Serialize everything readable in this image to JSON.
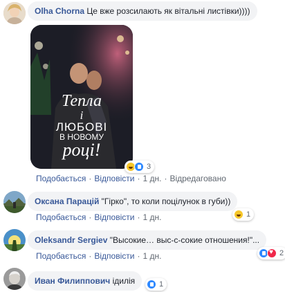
{
  "comments": [
    {
      "author": "Olha Chorna",
      "text": "Це вже розсилають як вітальні листівки))))",
      "image_caption": {
        "line1": "Тепла",
        "line2": "і",
        "line3": "ЛЮБОВІ",
        "line4": "В НОВОМУ",
        "line5": "році!"
      },
      "reactions": {
        "icons": [
          "haha-icon",
          "like-icon"
        ],
        "count": "3"
      },
      "actions": {
        "like": "Подобається",
        "reply": "Відповісти",
        "time": "1 дн.",
        "edited": "Відредаговано"
      }
    },
    {
      "author": "Оксана Парацій",
      "text": "\"Гірко\", то коли поцілунок в губи))",
      "reactions": {
        "icons": [
          "haha-icon"
        ],
        "count": "1"
      },
      "actions": {
        "like": "Подобається",
        "reply": "Відповісти",
        "time": "1 дн."
      }
    },
    {
      "author": "Oleksandr Sergiev",
      "text": "\"Высокие… выс-с-сокие отношения!\"...",
      "reactions": {
        "icons": [
          "like-icon",
          "love-icon"
        ],
        "count": "2"
      },
      "actions": {
        "like": "Подобається",
        "reply": "Відповісти",
        "time": "1 дн."
      }
    },
    {
      "author": "Иван Филиппович",
      "text": "ідилія",
      "reactions": {
        "icons": [
          "like-icon"
        ],
        "count": "1"
      },
      "actions": {}
    }
  ],
  "colors": {
    "author_link": "#385898",
    "bubble_bg": "#f2f3f5",
    "meta_text": "#606770"
  }
}
